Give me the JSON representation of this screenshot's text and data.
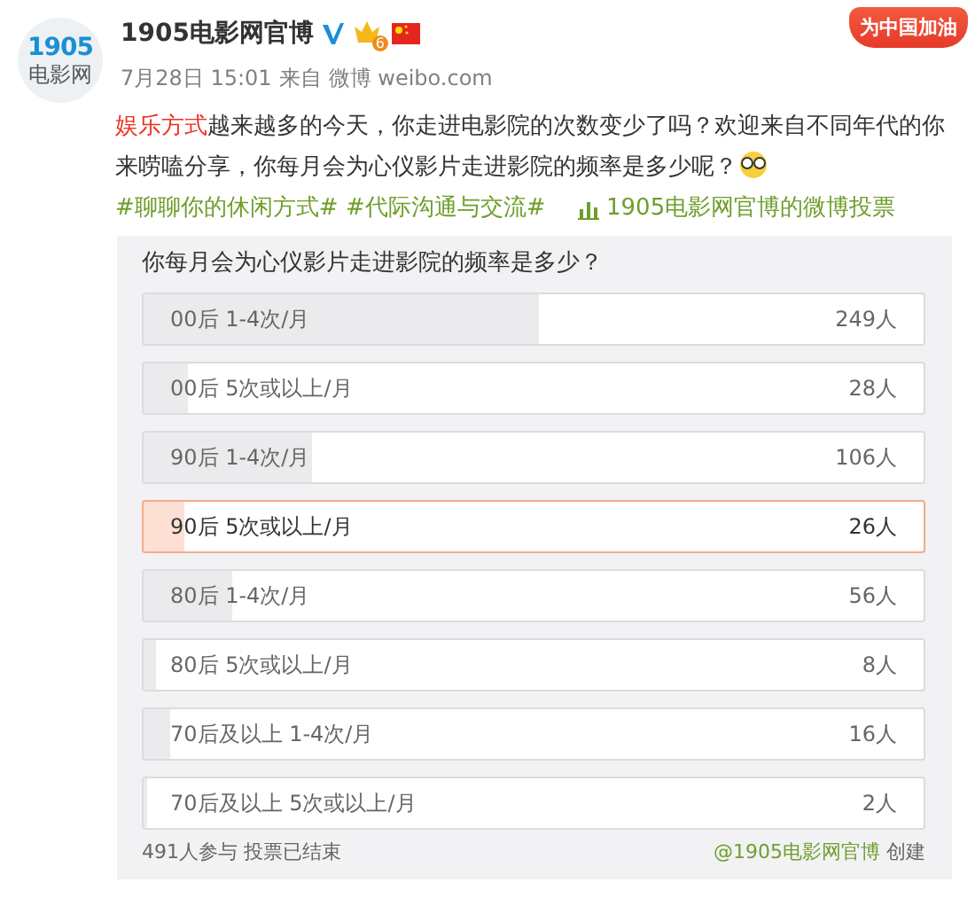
{
  "header": {
    "logo_digits": "1905",
    "logo_text": "电影网",
    "author": "1905电影网官博",
    "verified": true,
    "member_level": "6",
    "time": "7月28日 15:01",
    "source_prefix": "来自",
    "source": "微博 weibo.com",
    "badge": "为中国加油"
  },
  "post": {
    "segments": [
      {
        "kind": "link",
        "text": "娱乐方式"
      },
      {
        "kind": "text",
        "text": "越来越多的今天，你走进电影院的次数变少了吗？欢迎来自不同年代的你来唠嗑分享，你每月会为心仪影片走进影院的频率是多少呢？"
      },
      {
        "kind": "emoji"
      },
      {
        "kind": "hashtag",
        "text": "#聊聊你的休闲方式#"
      },
      {
        "kind": "hashtag",
        "text": "#代际沟通与交流#"
      },
      {
        "kind": "poll_link",
        "text": "1905电影网官博的微博投票"
      }
    ]
  },
  "poll": {
    "question": "你每月会为心仪影片走进影院的频率是多少？",
    "options": [
      {
        "label": "00后 1-4次/月",
        "count": "249人",
        "level": 0.507,
        "selected": false
      },
      {
        "label": "00后 5次或以上/月",
        "count": "28人",
        "level": 0.057,
        "selected": false
      },
      {
        "label": "90后 1-4次/月",
        "count": "106人",
        "level": 0.216,
        "selected": false
      },
      {
        "label": "90后 5次或以上/月",
        "count": "26人",
        "level": 0.053,
        "selected": true
      },
      {
        "label": "80后 1-4次/月",
        "count": "56人",
        "level": 0.114,
        "selected": false
      },
      {
        "label": "80后 5次或以上/月",
        "count": "8人",
        "level": 0.016,
        "selected": false
      },
      {
        "label": "70后及以上 1-4次/月",
        "count": "16人",
        "level": 0.033,
        "selected": false
      },
      {
        "label": "70后及以上 5次或以上/月",
        "count": "2人",
        "level": 0.004,
        "selected": false
      }
    ],
    "participants": "491人参与",
    "status": "投票已结束",
    "creator": "@1905电影网官博",
    "created": "创建"
  }
}
